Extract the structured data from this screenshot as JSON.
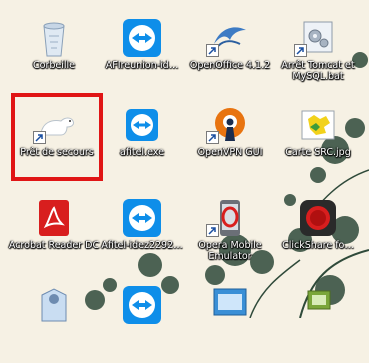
{
  "desktop": {
    "icons": [
      {
        "label": "Corbeille",
        "icon": "recycle-bin-icon"
      },
      {
        "label": "AFIreunion-id…",
        "icon": "teamviewer-icon"
      },
      {
        "label": "OpenOffice 4.1.2",
        "icon": "openoffice-icon"
      },
      {
        "label": "Arrêt Tomcat et MySQL.bat",
        "icon": "batch-file-icon"
      },
      {
        "label": "Prêt de secours",
        "icon": "polar-bear-icon"
      },
      {
        "label": "afitel.exe",
        "icon": "teamviewer-icon"
      },
      {
        "label": "OpenVPN GUI",
        "icon": "openvpn-icon"
      },
      {
        "label": "Carte SRC.jpg",
        "icon": "map-image-icon"
      },
      {
        "label": "Acrobat Reader DC",
        "icon": "acrobat-icon"
      },
      {
        "label": "Afitel-idez2292…",
        "icon": "teamviewer-icon"
      },
      {
        "label": "Opera Mobile Emulator",
        "icon": "opera-mobile-icon"
      },
      {
        "label": "ClickShare fo…",
        "icon": "clickshare-icon"
      },
      {
        "label": "",
        "icon": "installer-icon"
      },
      {
        "label": "",
        "icon": "teamviewer-icon"
      },
      {
        "label": "",
        "icon": "computer-window-icon"
      },
      {
        "label": "",
        "icon": "network-computer-icon"
      }
    ]
  },
  "colors": {
    "highlight": "#e01515",
    "teamviewer_blue": "#0e8ee9"
  }
}
